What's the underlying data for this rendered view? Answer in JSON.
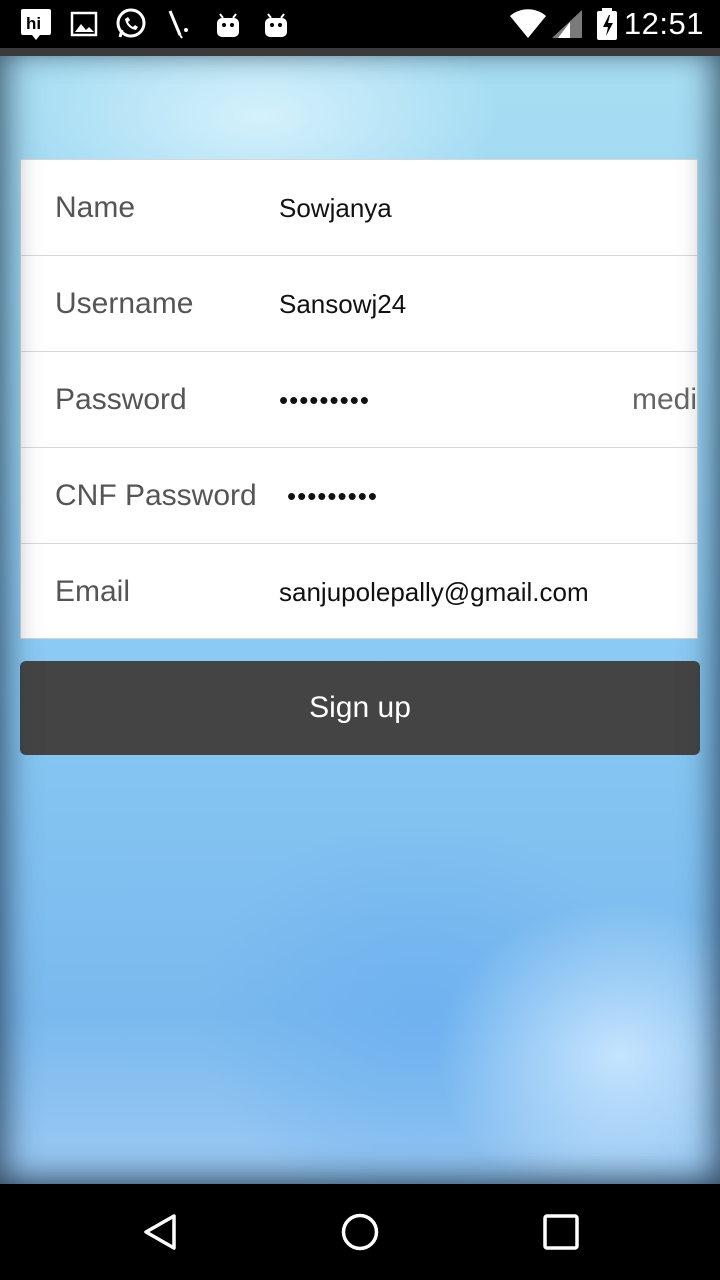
{
  "status_bar": {
    "time": "12:51",
    "icons": [
      "hi-app-icon",
      "image-icon",
      "whatsapp-icon",
      "tool-icon",
      "android-icon",
      "android-icon",
      "wifi-icon",
      "signal-icon",
      "battery-icon"
    ]
  },
  "form": {
    "fields": [
      {
        "label": "Name",
        "value": "Sowjanya"
      },
      {
        "label": "Username",
        "value": "Sansowj24"
      },
      {
        "label": "Password",
        "value": "•••••••••",
        "strength": "medi"
      },
      {
        "label": "CNF Password",
        "value": "•••••••••"
      },
      {
        "label": "Email",
        "value": "sanjupolepally@gmail.com"
      }
    ]
  },
  "actions": {
    "signup_label": "Sign up"
  },
  "colors": {
    "button": "#444444",
    "background_accent": "#86c6f2"
  }
}
